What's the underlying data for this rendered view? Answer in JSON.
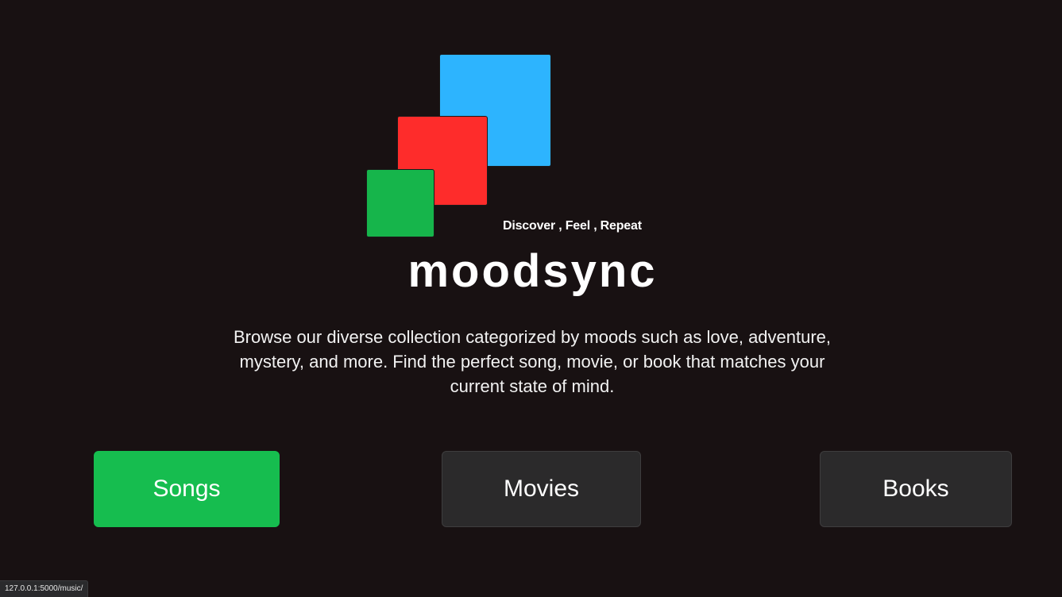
{
  "logo": {
    "squares": [
      {
        "name": "blue",
        "color": "#2db4fe"
      },
      {
        "name": "red",
        "color": "#fe2c2b"
      },
      {
        "name": "green",
        "color": "#16b54b"
      }
    ],
    "tagline": "Discover , Feel , Repeat",
    "brand_name": "moodsync"
  },
  "description": "Browse our diverse collection categorized by moods such as love, adventure, mystery, and more. Find the perfect song, movie, or book that matches your current state of mind.",
  "categories": [
    {
      "label": "Songs",
      "color": "#16bd4f",
      "active": true
    },
    {
      "label": "Movies",
      "color": "#2b2a2b",
      "active": false
    },
    {
      "label": "Books",
      "color": "#2b2a2b",
      "active": false
    }
  ],
  "status_bar": {
    "url": "127.0.0.1:5000/music/"
  },
  "colors": {
    "background": "#181112",
    "text": "#ffffff"
  }
}
